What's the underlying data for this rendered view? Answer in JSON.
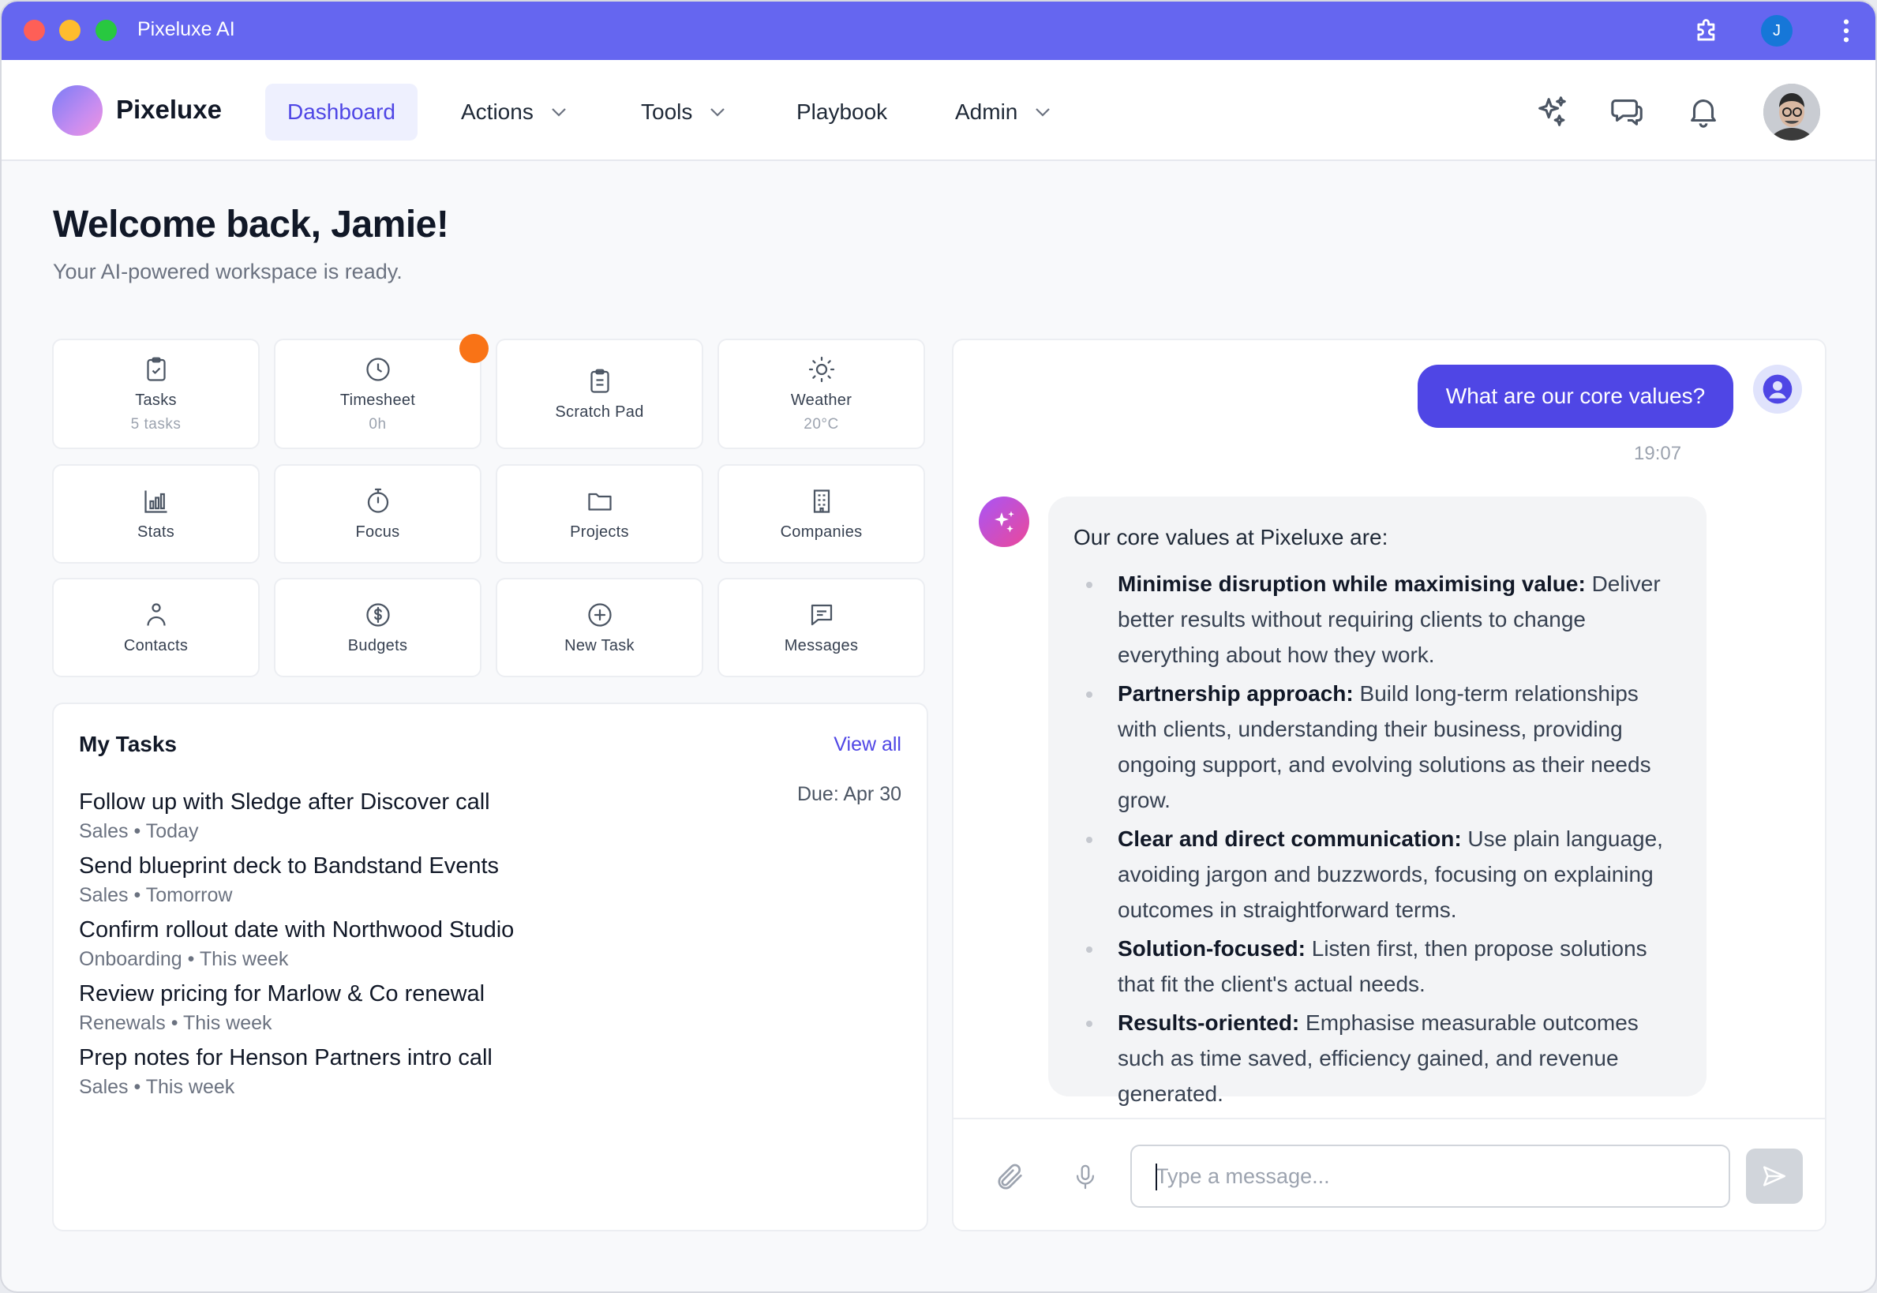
{
  "window": {
    "title": "Pixeluxe AI",
    "account_initial": "J"
  },
  "nav": {
    "brand": "Pixeluxe",
    "items": [
      {
        "label": "Dashboard",
        "active": true
      },
      {
        "label": "Actions",
        "dropdown": true
      },
      {
        "label": "Tools",
        "dropdown": true
      },
      {
        "label": "Playbook"
      },
      {
        "label": "Admin",
        "dropdown": true
      }
    ],
    "icons": [
      "sparkles-icon",
      "chat-icon",
      "bell-icon"
    ]
  },
  "welcome": {
    "title": "Welcome back, Jamie!",
    "subtitle": "Your AI-powered workspace is ready."
  },
  "tiles": [
    {
      "label": "Tasks",
      "sub": "5 tasks",
      "icon": "clipboard-check-icon"
    },
    {
      "label": "Timesheet",
      "sub": "0h",
      "icon": "clock-icon"
    },
    {
      "label": "Scratch Pad",
      "sub": "",
      "icon": "clipboard-icon"
    },
    {
      "label": "Weather",
      "sub": "20°C",
      "icon": "sun-icon"
    },
    {
      "label": "Stats",
      "icon": "bar-chart-icon"
    },
    {
      "label": "Focus",
      "icon": "stopwatch-icon"
    },
    {
      "label": "Projects",
      "icon": "folder-icon"
    },
    {
      "label": "Companies",
      "icon": "building-icon"
    },
    {
      "label": "Contacts",
      "icon": "person-icon"
    },
    {
      "label": "Budgets",
      "icon": "dollar-icon"
    },
    {
      "label": "New Task",
      "icon": "plus-circle-icon"
    },
    {
      "label": "Messages",
      "icon": "message-icon"
    }
  ],
  "tasks": {
    "title": "My Tasks",
    "view_all": "View all",
    "due": "Due: Apr 30",
    "items": [
      {
        "title": "Follow up with Sledge after Discover call",
        "meta": "Sales • Today"
      },
      {
        "title": "Send blueprint deck to Bandstand Events",
        "meta": "Sales • Tomorrow"
      },
      {
        "title": "Confirm rollout date with Northwood Studio",
        "meta": "Onboarding • This week"
      },
      {
        "title": "Review pricing for Marlow & Co renewal",
        "meta": "Renewals • This week"
      },
      {
        "title": "Prep notes for Henson Partners intro call",
        "meta": "Sales • This week"
      }
    ]
  },
  "chat": {
    "user_message": "What are our core values?",
    "time": "19:07",
    "ai_intro": "Our core values at Pixeluxe are:",
    "values": [
      {
        "title": "Minimise disruption while maximising value:",
        "text": " Deliver better results without requiring clients to change everything about how they work."
      },
      {
        "title": "Partnership approach:",
        "text": " Build long-term relationships with clients, understanding their business, providing ongoing support, and evolving solutions as their needs grow."
      },
      {
        "title": "Clear and direct communication:",
        "text": " Use plain language, avoiding jargon and buzzwords, focusing on explaining outcomes in straightforward terms."
      },
      {
        "title": "Solution-focused:",
        "text": " Listen first, then propose solutions that fit the client's actual needs."
      },
      {
        "title": "Results-oriented:",
        "text": " Emphasise measurable outcomes such as time saved, efficiency gained, and revenue generated."
      }
    ],
    "composer": {
      "placeholder": "Type a message...",
      "value": ""
    }
  },
  "colors": {
    "titlebar": "#6566f0",
    "accent": "#4f46e5",
    "badge": "#f97316"
  }
}
